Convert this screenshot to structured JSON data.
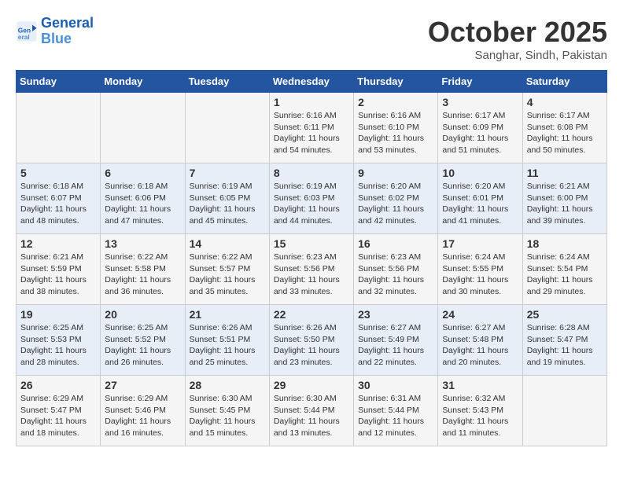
{
  "logo": {
    "line1": "General",
    "line2": "Blue"
  },
  "title": "October 2025",
  "subtitle": "Sanghar, Sindh, Pakistan",
  "weekdays": [
    "Sunday",
    "Monday",
    "Tuesday",
    "Wednesday",
    "Thursday",
    "Friday",
    "Saturday"
  ],
  "weeks": [
    [
      {
        "day": "",
        "info": ""
      },
      {
        "day": "",
        "info": ""
      },
      {
        "day": "",
        "info": ""
      },
      {
        "day": "1",
        "info": "Sunrise: 6:16 AM\nSunset: 6:11 PM\nDaylight: 11 hours\nand 54 minutes."
      },
      {
        "day": "2",
        "info": "Sunrise: 6:16 AM\nSunset: 6:10 PM\nDaylight: 11 hours\nand 53 minutes."
      },
      {
        "day": "3",
        "info": "Sunrise: 6:17 AM\nSunset: 6:09 PM\nDaylight: 11 hours\nand 51 minutes."
      },
      {
        "day": "4",
        "info": "Sunrise: 6:17 AM\nSunset: 6:08 PM\nDaylight: 11 hours\nand 50 minutes."
      }
    ],
    [
      {
        "day": "5",
        "info": "Sunrise: 6:18 AM\nSunset: 6:07 PM\nDaylight: 11 hours\nand 48 minutes."
      },
      {
        "day": "6",
        "info": "Sunrise: 6:18 AM\nSunset: 6:06 PM\nDaylight: 11 hours\nand 47 minutes."
      },
      {
        "day": "7",
        "info": "Sunrise: 6:19 AM\nSunset: 6:05 PM\nDaylight: 11 hours\nand 45 minutes."
      },
      {
        "day": "8",
        "info": "Sunrise: 6:19 AM\nSunset: 6:03 PM\nDaylight: 11 hours\nand 44 minutes."
      },
      {
        "day": "9",
        "info": "Sunrise: 6:20 AM\nSunset: 6:02 PM\nDaylight: 11 hours\nand 42 minutes."
      },
      {
        "day": "10",
        "info": "Sunrise: 6:20 AM\nSunset: 6:01 PM\nDaylight: 11 hours\nand 41 minutes."
      },
      {
        "day": "11",
        "info": "Sunrise: 6:21 AM\nSunset: 6:00 PM\nDaylight: 11 hours\nand 39 minutes."
      }
    ],
    [
      {
        "day": "12",
        "info": "Sunrise: 6:21 AM\nSunset: 5:59 PM\nDaylight: 11 hours\nand 38 minutes."
      },
      {
        "day": "13",
        "info": "Sunrise: 6:22 AM\nSunset: 5:58 PM\nDaylight: 11 hours\nand 36 minutes."
      },
      {
        "day": "14",
        "info": "Sunrise: 6:22 AM\nSunset: 5:57 PM\nDaylight: 11 hours\nand 35 minutes."
      },
      {
        "day": "15",
        "info": "Sunrise: 6:23 AM\nSunset: 5:56 PM\nDaylight: 11 hours\nand 33 minutes."
      },
      {
        "day": "16",
        "info": "Sunrise: 6:23 AM\nSunset: 5:56 PM\nDaylight: 11 hours\nand 32 minutes."
      },
      {
        "day": "17",
        "info": "Sunrise: 6:24 AM\nSunset: 5:55 PM\nDaylight: 11 hours\nand 30 minutes."
      },
      {
        "day": "18",
        "info": "Sunrise: 6:24 AM\nSunset: 5:54 PM\nDaylight: 11 hours\nand 29 minutes."
      }
    ],
    [
      {
        "day": "19",
        "info": "Sunrise: 6:25 AM\nSunset: 5:53 PM\nDaylight: 11 hours\nand 28 minutes."
      },
      {
        "day": "20",
        "info": "Sunrise: 6:25 AM\nSunset: 5:52 PM\nDaylight: 11 hours\nand 26 minutes."
      },
      {
        "day": "21",
        "info": "Sunrise: 6:26 AM\nSunset: 5:51 PM\nDaylight: 11 hours\nand 25 minutes."
      },
      {
        "day": "22",
        "info": "Sunrise: 6:26 AM\nSunset: 5:50 PM\nDaylight: 11 hours\nand 23 minutes."
      },
      {
        "day": "23",
        "info": "Sunrise: 6:27 AM\nSunset: 5:49 PM\nDaylight: 11 hours\nand 22 minutes."
      },
      {
        "day": "24",
        "info": "Sunrise: 6:27 AM\nSunset: 5:48 PM\nDaylight: 11 hours\nand 20 minutes."
      },
      {
        "day": "25",
        "info": "Sunrise: 6:28 AM\nSunset: 5:47 PM\nDaylight: 11 hours\nand 19 minutes."
      }
    ],
    [
      {
        "day": "26",
        "info": "Sunrise: 6:29 AM\nSunset: 5:47 PM\nDaylight: 11 hours\nand 18 minutes."
      },
      {
        "day": "27",
        "info": "Sunrise: 6:29 AM\nSunset: 5:46 PM\nDaylight: 11 hours\nand 16 minutes."
      },
      {
        "day": "28",
        "info": "Sunrise: 6:30 AM\nSunset: 5:45 PM\nDaylight: 11 hours\nand 15 minutes."
      },
      {
        "day": "29",
        "info": "Sunrise: 6:30 AM\nSunset: 5:44 PM\nDaylight: 11 hours\nand 13 minutes."
      },
      {
        "day": "30",
        "info": "Sunrise: 6:31 AM\nSunset: 5:44 PM\nDaylight: 11 hours\nand 12 minutes."
      },
      {
        "day": "31",
        "info": "Sunrise: 6:32 AM\nSunset: 5:43 PM\nDaylight: 11 hours\nand 11 minutes."
      },
      {
        "day": "",
        "info": ""
      }
    ]
  ]
}
